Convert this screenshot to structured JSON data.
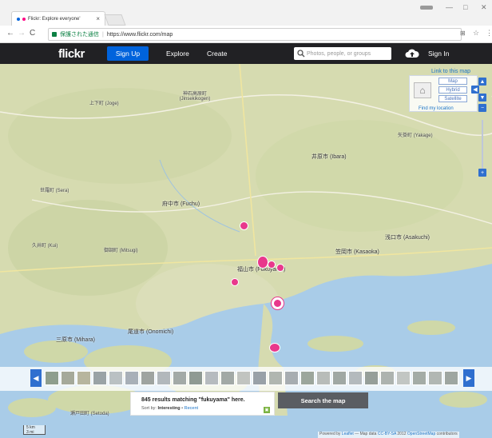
{
  "browser": {
    "tab_title": "Flickr: Explore everyone'",
    "tab_close": "×",
    "window_controls": [
      "—",
      "□",
      "✕"
    ],
    "back": "←",
    "forward": "→",
    "reload": "C",
    "secure_label": "保護された通信",
    "url": "https://www.flickr.com/map"
  },
  "header": {
    "logo": "flickr",
    "signup_label": "Sign Up",
    "explore_label": "Explore",
    "create_label": "Create",
    "search_placeholder": "Photos, people, or groups",
    "signin_label": "Sign In"
  },
  "map_controls": {
    "link_to_map": "Link to this map",
    "types": [
      "Map",
      "Hybrid",
      "Satellite"
    ],
    "find_location": "Find my location",
    "zoom_in": "+",
    "zoom_out": "−"
  },
  "places": [
    {
      "name": "上下町 (Joge)"
    },
    {
      "name": "神石高原町 (Jinsekikogen)"
    },
    {
      "name": "矢掛町 (Yakage)"
    },
    {
      "name": "井原市 (Ibara)"
    },
    {
      "name": "世羅町 (Sera)"
    },
    {
      "name": "府中市 (Fuchu)"
    },
    {
      "name": "久井町 (Kui)"
    },
    {
      "name": "御調町 (Mitsugi)"
    },
    {
      "name": "浅口市 (Asakuchi)"
    },
    {
      "name": "笠岡市 (Kasaoka)"
    },
    {
      "name": "福山市 (Fukuyama)"
    },
    {
      "name": "尾道市 (Onomichi)"
    },
    {
      "name": "三原市 (Mihara)"
    },
    {
      "name": "瀬戸田町 (Setoda)"
    }
  ],
  "results": {
    "text": "845 results matching \"fukuyama\" here.",
    "sort_prefix": "Sort by:",
    "sort_interesting": "Interesting",
    "sort_sep": "•",
    "sort_recent": "Recent",
    "search_map_label": "Search the map"
  },
  "scale": {
    "km": "5 km",
    "mi": "3 mi"
  },
  "attribution": {
    "powered": "Powered by",
    "leaflet": "Leaflet",
    "data": "— Map data",
    "license": "CC-BY-SA",
    "year": "2012",
    "osm": "OpenStreetMap",
    "contrib": "contributors"
  },
  "colors": {
    "flickr_blue": "#0063dc",
    "flickr_pink": "#ff0084",
    "pin": "#e8388c",
    "sea": "#a9cce8",
    "land": "#d8ddb4",
    "header_bg": "#212124"
  }
}
